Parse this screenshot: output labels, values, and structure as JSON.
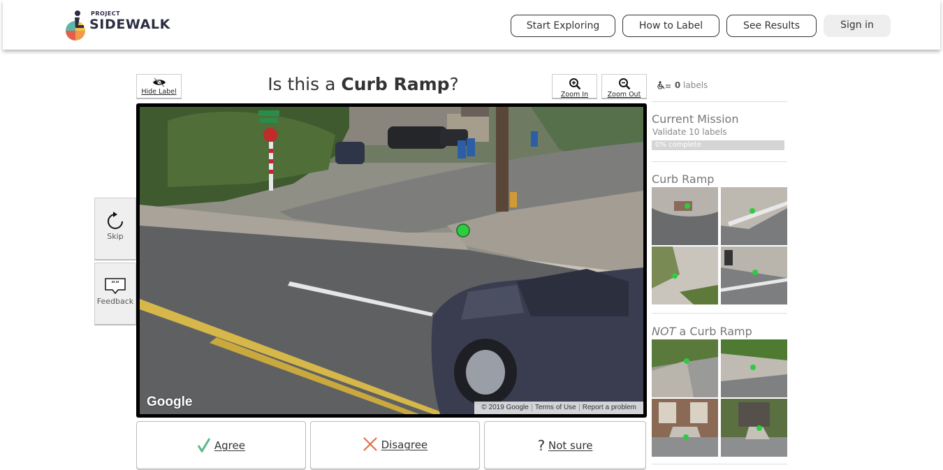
{
  "nav": {
    "logo_small": "PROJECT",
    "logo_big": "SIDEWALK",
    "start_exploring": "Start Exploring",
    "how_to_label": "How to Label",
    "see_results": "See Results",
    "sign_in": "Sign in"
  },
  "toolbar": {
    "hide_label": "Hide Label",
    "zoom_in": "Zoom In",
    "zoom_out": "Zoom Out"
  },
  "question": {
    "prefix": "Is this a ",
    "label_type": "Curb Ramp",
    "suffix": "?"
  },
  "side_buttons": {
    "skip": "Skip",
    "feedback": "Feedback"
  },
  "pano": {
    "google_logo": "Google",
    "copyright": "© 2019 Google",
    "terms": "Terms of Use",
    "report": "Report a problem"
  },
  "actions": {
    "agree": "Agree",
    "disagree": "Disagree",
    "not_sure": "Not sure"
  },
  "sidebar": {
    "label_count": "0",
    "label_unit": "labels",
    "mission_title": "Current Mission",
    "mission_desc": "Validate 10 labels",
    "progress_text": "0% complete",
    "progress_fraction": 0,
    "examples_title": "Curb Ramp",
    "counter_examples_prefix": "NOT",
    "counter_examples_suffix": " a Curb Ramp"
  },
  "colors": {
    "agree_check": "#5cb88a",
    "disagree_x": "#e06a3c",
    "label_marker": "#2ecc40",
    "progress_bar": "#d5d5d5"
  }
}
